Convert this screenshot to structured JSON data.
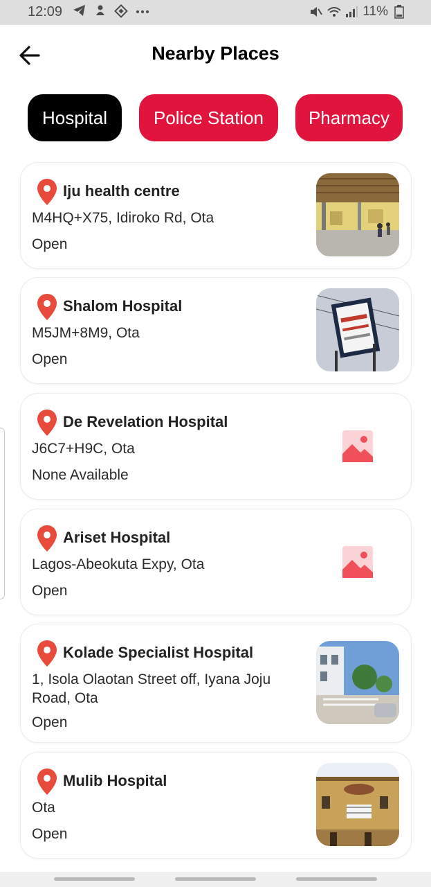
{
  "status_bar": {
    "time": "12:09",
    "battery": "11%",
    "left_icons": [
      "telegram-icon",
      "notification-icon",
      "app-icon",
      "more-icon"
    ],
    "right_icons": [
      "mute-icon",
      "wifi-icon",
      "signal-icon",
      "battery-icon"
    ]
  },
  "header": {
    "title": "Nearby Places",
    "back_icon": "back-arrow-icon"
  },
  "tabs": [
    {
      "label": "Hospital",
      "active": true
    },
    {
      "label": "Police Station",
      "active": false
    },
    {
      "label": "Pharmacy",
      "active": false
    }
  ],
  "colors": {
    "accent": "#e0143c",
    "active_chip": "#000000",
    "pin": "#e84a3c",
    "placeholder": "#f0505a"
  },
  "places": [
    {
      "name": "Iju health centre",
      "address": "M4HQ+X75, Idiroko Rd, Ota",
      "status": "Open",
      "has_photo": true
    },
    {
      "name": "Shalom Hospital",
      "address": "M5JM+8M9, Ota",
      "status": "Open",
      "has_photo": true
    },
    {
      "name": "De Revelation Hospital",
      "address": "J6C7+H9C, Ota",
      "status": "None Available",
      "has_photo": false
    },
    {
      "name": "Ariset Hospital",
      "address": "Lagos-Abeokuta Expy, Ota",
      "status": "Open",
      "has_photo": false
    },
    {
      "name": "Kolade Specialist Hospital",
      "address": "1, Isola Olaotan Street off, Iyana Joju Road, Ota",
      "status": "Open",
      "has_photo": true
    },
    {
      "name": "Mulib Hospital",
      "address": "Ota",
      "status": "Open",
      "has_photo": true
    }
  ]
}
